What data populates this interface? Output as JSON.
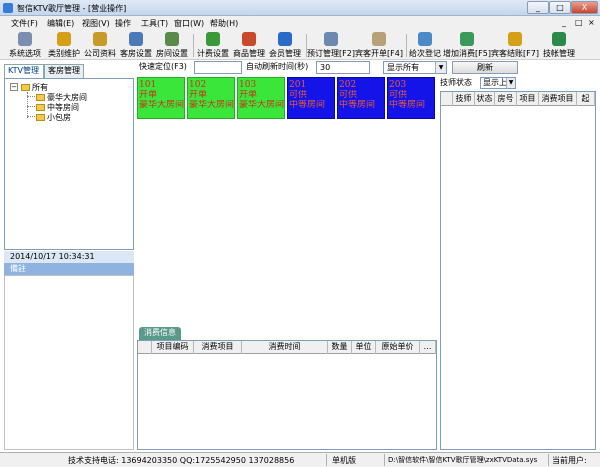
{
  "window": {
    "title": "智信KTV歌厅管理 - [营业操作]",
    "min": "_",
    "max": "□",
    "close": "X"
  },
  "menu": [
    "文件(F)",
    "编辑(E)",
    "视图(V)",
    "操作",
    "工具(T)",
    "窗口(W)",
    "帮助(H)"
  ],
  "mdi_controls": [
    "_",
    "□",
    "×"
  ],
  "toolbar": [
    {
      "label": "系统选项",
      "icon": "settings-icon",
      "color": "#7a8fb0"
    },
    {
      "label": "类别维护",
      "icon": "key-icon",
      "color": "#d4a017"
    },
    {
      "label": "公司资料",
      "icon": "company-icon",
      "color": "#c89a2a"
    },
    {
      "label": "客房设置",
      "icon": "room-setup-icon",
      "color": "#4a7ab8"
    },
    {
      "label": "房间设置",
      "icon": "room-icon",
      "color": "#5a8a4a"
    },
    {
      "label": "计费设置",
      "icon": "billing-icon",
      "color": "#3a9a3a"
    },
    {
      "label": "商品管理",
      "icon": "goods-icon",
      "color": "#c84a2a"
    },
    {
      "label": "会员管理",
      "icon": "member-icon",
      "color": "#2a6ac8"
    },
    {
      "label": "预订管理[F2]",
      "icon": "booking-icon",
      "color": "#6a8ab0"
    },
    {
      "label": "宾客开单[F4]",
      "icon": "checkin-icon",
      "color": "#b8a07a"
    },
    {
      "label": "给次登记",
      "icon": "register-icon",
      "color": "#4a8ac8"
    },
    {
      "label": "增加消费[F5]",
      "icon": "add-consume-icon",
      "color": "#3a9a5a"
    },
    {
      "label": "宾客结账[F7]",
      "icon": "checkout-icon",
      "color": "#d4a017"
    },
    {
      "label": "技帐管理",
      "icon": "tech-icon",
      "color": "#2a8a4a"
    }
  ],
  "tabs": [
    "KTV管理",
    "客房管理"
  ],
  "tree": {
    "root": "所有",
    "children": [
      "豪华大房间",
      "中等房间",
      "小包房"
    ]
  },
  "datetime": "2014/10/17 10:34:31",
  "note_label": "備註",
  "filter": {
    "quick_label": "快速定位(F3)",
    "quick_value": "",
    "auto_label": "自动刷新时间(秒)",
    "auto_value": "30",
    "display_value": "显示所有",
    "refresh_label": "刷新"
  },
  "rooms": [
    {
      "no": "101",
      "status": "开单",
      "type": "豪华大房间",
      "color": "green"
    },
    {
      "no": "102",
      "status": "开单",
      "type": "豪华大房间",
      "color": "green"
    },
    {
      "no": "103",
      "status": "开单",
      "type": "豪华大房间",
      "color": "green"
    },
    {
      "no": "201",
      "status": "可供",
      "type": "中等房间",
      "color": "blue"
    },
    {
      "no": "202",
      "status": "可供",
      "type": "中等房间",
      "color": "blue"
    },
    {
      "no": "203",
      "status": "可供",
      "type": "中等房间",
      "color": "blue"
    }
  ],
  "consume": {
    "tab": "消费信息",
    "columns": [
      "项目编码",
      "消费项目",
      "消费时间",
      "数量",
      "单位",
      "原始单价",
      "…"
    ]
  },
  "tech": {
    "label": "技师状态",
    "select": "显示上",
    "columns": [
      "技师",
      "状态",
      "房号",
      "项目",
      "消费项目",
      "起"
    ]
  },
  "status": {
    "support": "技术支持电话: 13694203350 QQ:1725542950 137028856",
    "mode": "单机版",
    "path": "D:\\智信软件\\智信KTV歌厅管理\\zxKTVData.sys",
    "user": "当前用户:"
  }
}
